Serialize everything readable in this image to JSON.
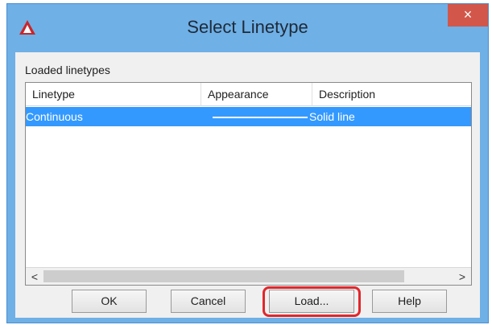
{
  "window": {
    "title": "Select Linetype",
    "close_label": "×"
  },
  "loaded_group": {
    "label": "Loaded linetypes"
  },
  "list": {
    "columns": [
      "Linetype",
      "Appearance",
      "Description"
    ],
    "rows": [
      {
        "linetype": "Continuous",
        "description": "Solid line",
        "selected": true
      }
    ]
  },
  "scrollbar": {
    "left_arrow": "<",
    "right_arrow": ">"
  },
  "buttons": {
    "ok": "OK",
    "cancel": "Cancel",
    "load": "Load...",
    "help": "Help"
  },
  "colors": {
    "selection": "#3399ff",
    "title_bar": "#6fb0e6",
    "close": "#d2574a",
    "highlight_ring": "#e0272c"
  },
  "icons": {
    "app": "autocad-icon",
    "close": "close-icon"
  }
}
